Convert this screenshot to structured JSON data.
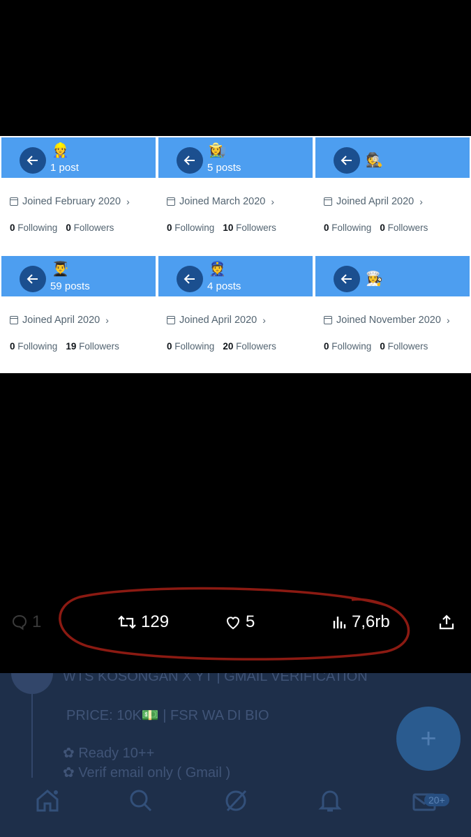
{
  "cards": [
    {
      "emoji": "👷",
      "posts": "1 post",
      "joined": "Joined February 2020",
      "following_count": "0",
      "following_label": "Following",
      "followers_count": "0",
      "followers_label": "Followers"
    },
    {
      "emoji": "👩‍🌾",
      "posts": "5 posts",
      "joined": "Joined March 2020",
      "following_count": "0",
      "following_label": "Following",
      "followers_count": "10",
      "followers_label": "Followers"
    },
    {
      "emoji": "🕵️",
      "posts": "",
      "joined": "Joined April 2020",
      "following_count": "0",
      "following_label": "Following",
      "followers_count": "0",
      "followers_label": "Followers"
    },
    {
      "emoji": "👨‍🎓",
      "posts": "59 posts",
      "joined": "Joined April 2020",
      "following_count": "0",
      "following_label": "Following",
      "followers_count": "19",
      "followers_label": "Followers"
    },
    {
      "emoji": "👮",
      "posts": "4 posts",
      "joined": "Joined April 2020",
      "following_count": "0",
      "following_label": "Following",
      "followers_count": "20",
      "followers_label": "Followers"
    },
    {
      "emoji": "👩‍🍳",
      "posts": "",
      "joined": "Joined November 2020",
      "following_count": "0",
      "following_label": "Following",
      "followers_count": "0",
      "followers_label": "Followers"
    }
  ],
  "actions": {
    "reply_count": "1",
    "repost_count": "129",
    "like_count": "5",
    "views_count": "7,6rb"
  },
  "background_tweet": {
    "line1": "WTS KOSONGAN X YT | GMAIL VERIFICATION",
    "line2": "PRICE: 10K💵 | FSR WA DI BIO",
    "line3": "✿ Ready 10++",
    "line4": "✿ Verif email only ( Gmail )"
  },
  "fab_label": "+",
  "messages_badge": "20+",
  "colors": {
    "header_blue": "#4d9ef0",
    "back_button": "#1b4f8f",
    "annotation_red": "#8b1a12"
  }
}
